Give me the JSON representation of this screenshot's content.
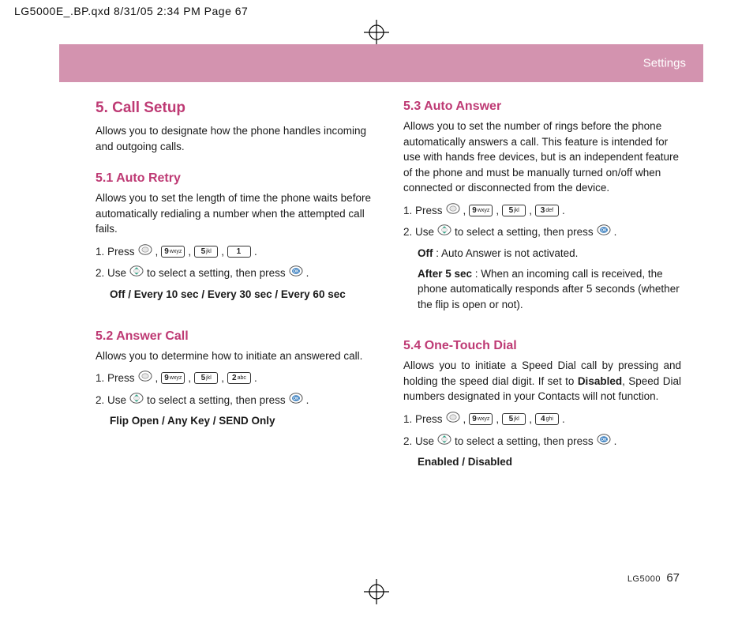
{
  "print_header": "LG5000E_.BP.qxd  8/31/05  2:34 PM  Page 67",
  "banner_label": "Settings",
  "footer_model": "LG5000",
  "footer_page": "67",
  "keys": {
    "k9": {
      "num": "9",
      "lbl": "wxyz"
    },
    "k5": {
      "num": "5",
      "lbl": "jkl"
    },
    "k1": {
      "num": "1",
      "lbl": ""
    },
    "k2": {
      "num": "2",
      "lbl": "abc"
    },
    "k3": {
      "num": "3",
      "lbl": "def"
    },
    "k4": {
      "num": "4",
      "lbl": "ghi"
    }
  },
  "left": {
    "h1": "5. Call Setup",
    "intro": "Allows you to designate how the phone handles incoming and outgoing calls.",
    "s51": {
      "title": "5.1 Auto Retry",
      "desc": "Allows you to set the length of time the phone waits before automatically redialing a number when the attempted call fails.",
      "step1_a": "1. Press",
      "step1_b": ",",
      "step1_c": ",",
      "step1_d": ",",
      "step1_e": ".",
      "step2_a": "2. Use",
      "step2_b": "to select a setting, then press",
      "step2_c": ".",
      "opts": "Off / Every 10 sec / Every 30 sec / Every 60 sec"
    },
    "s52": {
      "title": "5.2 Answer Call",
      "desc": "Allows you to determine how to initiate an answered call.",
      "step1_a": "1. Press",
      "step1_b": ",",
      "step1_c": ",",
      "step1_d": ",",
      "step1_e": ".",
      "step2_a": "2. Use",
      "step2_b": " to select a setting, then press",
      "step2_c": ".",
      "opts": "Flip Open / Any Key / SEND Only"
    }
  },
  "right": {
    "s53": {
      "title": "5.3 Auto Answer",
      "desc": "Allows you to set the number of rings before the phone automatically answers a call. This feature is intended for use with hands free devices, but is an independent feature of the phone and must be manually turned on/off when connected or disconnected from the device.",
      "step1_a": "1. Press",
      "step1_b": ",",
      "step1_c": ",",
      "step1_d": ",",
      "step1_e": ".",
      "step2_a": "2. Use",
      "step2_b": "to select a setting, then press",
      "step2_c": ".",
      "off_lbl": "Off",
      "off_txt": " : Auto Answer is not activated.",
      "after_lbl": "After 5 sec",
      "after_txt": " : When an incoming call is received, the phone automatically responds after 5 seconds (whether the flip is open or not)."
    },
    "s54": {
      "title": "5.4 One-Touch Dial",
      "desc_a": "Allows you to initiate a Speed Dial call by pressing and holding the speed dial digit. If set to ",
      "desc_b": "Disabled",
      "desc_c": ", Speed Dial numbers designated in your Contacts will not function.",
      "step1_a": "1. Press",
      "step1_b": ",",
      "step1_c": ",",
      "step1_d": ",",
      "step1_e": ".",
      "step2_a": "2. Use",
      "step2_b": "to select a setting, then press",
      "step2_c": ".",
      "opts": "Enabled / Disabled"
    }
  }
}
